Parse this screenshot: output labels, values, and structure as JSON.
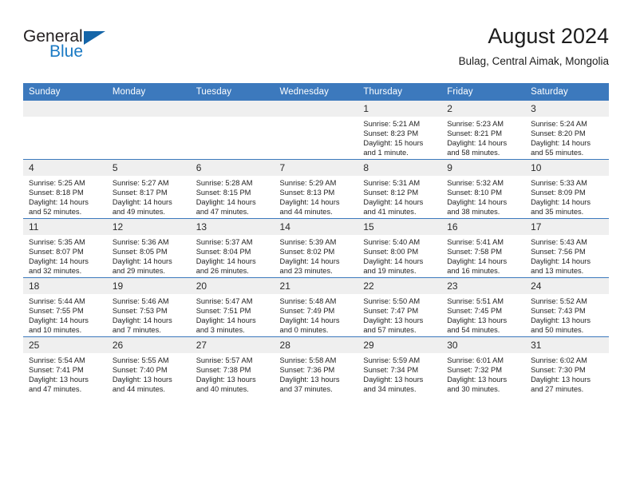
{
  "brand": {
    "name_part1": "General",
    "name_part2": "Blue",
    "triangle_color": "#1565a8",
    "blue_text_color": "#1a7ac4"
  },
  "header": {
    "title": "August 2024",
    "subtitle": "Bulag, Central Aimak, Mongolia"
  },
  "theme": {
    "header_bg": "#3c79bd",
    "header_text": "#ffffff",
    "daynum_bg": "#efefef",
    "grid_line": "#3c79bd"
  },
  "weekdays": [
    "Sunday",
    "Monday",
    "Tuesday",
    "Wednesday",
    "Thursday",
    "Friday",
    "Saturday"
  ],
  "weeks": [
    [
      {
        "day": "",
        "empty": true,
        "sunrise": "",
        "sunset": "",
        "daylight": ""
      },
      {
        "day": "",
        "empty": true,
        "sunrise": "",
        "sunset": "",
        "daylight": ""
      },
      {
        "day": "",
        "empty": true,
        "sunrise": "",
        "sunset": "",
        "daylight": ""
      },
      {
        "day": "",
        "empty": true,
        "sunrise": "",
        "sunset": "",
        "daylight": ""
      },
      {
        "day": "1",
        "empty": false,
        "sunrise": "Sunrise: 5:21 AM",
        "sunset": "Sunset: 8:23 PM",
        "daylight": "Daylight: 15 hours and 1 minute."
      },
      {
        "day": "2",
        "empty": false,
        "sunrise": "Sunrise: 5:23 AM",
        "sunset": "Sunset: 8:21 PM",
        "daylight": "Daylight: 14 hours and 58 minutes."
      },
      {
        "day": "3",
        "empty": false,
        "sunrise": "Sunrise: 5:24 AM",
        "sunset": "Sunset: 8:20 PM",
        "daylight": "Daylight: 14 hours and 55 minutes."
      }
    ],
    [
      {
        "day": "4",
        "empty": false,
        "sunrise": "Sunrise: 5:25 AM",
        "sunset": "Sunset: 8:18 PM",
        "daylight": "Daylight: 14 hours and 52 minutes."
      },
      {
        "day": "5",
        "empty": false,
        "sunrise": "Sunrise: 5:27 AM",
        "sunset": "Sunset: 8:17 PM",
        "daylight": "Daylight: 14 hours and 49 minutes."
      },
      {
        "day": "6",
        "empty": false,
        "sunrise": "Sunrise: 5:28 AM",
        "sunset": "Sunset: 8:15 PM",
        "daylight": "Daylight: 14 hours and 47 minutes."
      },
      {
        "day": "7",
        "empty": false,
        "sunrise": "Sunrise: 5:29 AM",
        "sunset": "Sunset: 8:13 PM",
        "daylight": "Daylight: 14 hours and 44 minutes."
      },
      {
        "day": "8",
        "empty": false,
        "sunrise": "Sunrise: 5:31 AM",
        "sunset": "Sunset: 8:12 PM",
        "daylight": "Daylight: 14 hours and 41 minutes."
      },
      {
        "day": "9",
        "empty": false,
        "sunrise": "Sunrise: 5:32 AM",
        "sunset": "Sunset: 8:10 PM",
        "daylight": "Daylight: 14 hours and 38 minutes."
      },
      {
        "day": "10",
        "empty": false,
        "sunrise": "Sunrise: 5:33 AM",
        "sunset": "Sunset: 8:09 PM",
        "daylight": "Daylight: 14 hours and 35 minutes."
      }
    ],
    [
      {
        "day": "11",
        "empty": false,
        "sunrise": "Sunrise: 5:35 AM",
        "sunset": "Sunset: 8:07 PM",
        "daylight": "Daylight: 14 hours and 32 minutes."
      },
      {
        "day": "12",
        "empty": false,
        "sunrise": "Sunrise: 5:36 AM",
        "sunset": "Sunset: 8:05 PM",
        "daylight": "Daylight: 14 hours and 29 minutes."
      },
      {
        "day": "13",
        "empty": false,
        "sunrise": "Sunrise: 5:37 AM",
        "sunset": "Sunset: 8:04 PM",
        "daylight": "Daylight: 14 hours and 26 minutes."
      },
      {
        "day": "14",
        "empty": false,
        "sunrise": "Sunrise: 5:39 AM",
        "sunset": "Sunset: 8:02 PM",
        "daylight": "Daylight: 14 hours and 23 minutes."
      },
      {
        "day": "15",
        "empty": false,
        "sunrise": "Sunrise: 5:40 AM",
        "sunset": "Sunset: 8:00 PM",
        "daylight": "Daylight: 14 hours and 19 minutes."
      },
      {
        "day": "16",
        "empty": false,
        "sunrise": "Sunrise: 5:41 AM",
        "sunset": "Sunset: 7:58 PM",
        "daylight": "Daylight: 14 hours and 16 minutes."
      },
      {
        "day": "17",
        "empty": false,
        "sunrise": "Sunrise: 5:43 AM",
        "sunset": "Sunset: 7:56 PM",
        "daylight": "Daylight: 14 hours and 13 minutes."
      }
    ],
    [
      {
        "day": "18",
        "empty": false,
        "sunrise": "Sunrise: 5:44 AM",
        "sunset": "Sunset: 7:55 PM",
        "daylight": "Daylight: 14 hours and 10 minutes."
      },
      {
        "day": "19",
        "empty": false,
        "sunrise": "Sunrise: 5:46 AM",
        "sunset": "Sunset: 7:53 PM",
        "daylight": "Daylight: 14 hours and 7 minutes."
      },
      {
        "day": "20",
        "empty": false,
        "sunrise": "Sunrise: 5:47 AM",
        "sunset": "Sunset: 7:51 PM",
        "daylight": "Daylight: 14 hours and 3 minutes."
      },
      {
        "day": "21",
        "empty": false,
        "sunrise": "Sunrise: 5:48 AM",
        "sunset": "Sunset: 7:49 PM",
        "daylight": "Daylight: 14 hours and 0 minutes."
      },
      {
        "day": "22",
        "empty": false,
        "sunrise": "Sunrise: 5:50 AM",
        "sunset": "Sunset: 7:47 PM",
        "daylight": "Daylight: 13 hours and 57 minutes."
      },
      {
        "day": "23",
        "empty": false,
        "sunrise": "Sunrise: 5:51 AM",
        "sunset": "Sunset: 7:45 PM",
        "daylight": "Daylight: 13 hours and 54 minutes."
      },
      {
        "day": "24",
        "empty": false,
        "sunrise": "Sunrise: 5:52 AM",
        "sunset": "Sunset: 7:43 PM",
        "daylight": "Daylight: 13 hours and 50 minutes."
      }
    ],
    [
      {
        "day": "25",
        "empty": false,
        "sunrise": "Sunrise: 5:54 AM",
        "sunset": "Sunset: 7:41 PM",
        "daylight": "Daylight: 13 hours and 47 minutes."
      },
      {
        "day": "26",
        "empty": false,
        "sunrise": "Sunrise: 5:55 AM",
        "sunset": "Sunset: 7:40 PM",
        "daylight": "Daylight: 13 hours and 44 minutes."
      },
      {
        "day": "27",
        "empty": false,
        "sunrise": "Sunrise: 5:57 AM",
        "sunset": "Sunset: 7:38 PM",
        "daylight": "Daylight: 13 hours and 40 minutes."
      },
      {
        "day": "28",
        "empty": false,
        "sunrise": "Sunrise: 5:58 AM",
        "sunset": "Sunset: 7:36 PM",
        "daylight": "Daylight: 13 hours and 37 minutes."
      },
      {
        "day": "29",
        "empty": false,
        "sunrise": "Sunrise: 5:59 AM",
        "sunset": "Sunset: 7:34 PM",
        "daylight": "Daylight: 13 hours and 34 minutes."
      },
      {
        "day": "30",
        "empty": false,
        "sunrise": "Sunrise: 6:01 AM",
        "sunset": "Sunset: 7:32 PM",
        "daylight": "Daylight: 13 hours and 30 minutes."
      },
      {
        "day": "31",
        "empty": false,
        "sunrise": "Sunrise: 6:02 AM",
        "sunset": "Sunset: 7:30 PM",
        "daylight": "Daylight: 13 hours and 27 minutes."
      }
    ]
  ]
}
